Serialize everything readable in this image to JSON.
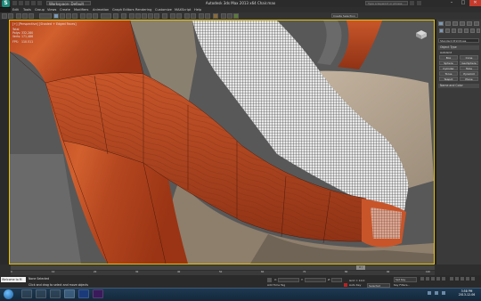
{
  "window": {
    "app_logo": "S",
    "workspace": "Workspace: Default",
    "title": "Autodesk 3ds Max  2013 x64     Chair.max",
    "search_placeholder": "Type a keyword or phrase"
  },
  "menu": [
    "Edit",
    "Tools",
    "Group",
    "Views",
    "Create",
    "Modifiers",
    "Animation",
    "Graph Editors",
    "Rendering",
    "Customize",
    "MAXScript",
    "Help"
  ],
  "toolbar": {
    "selection_set": "Create Selection Se"
  },
  "viewport": {
    "label": "[+] [Perspective] [Shaded + Edged Faces]",
    "stats": [
      {
        "label": "Total",
        "value": ""
      },
      {
        "label": "Polys:",
        "value": "332,280"
      },
      {
        "label": "Verts:",
        "value": "171,486"
      },
      {
        "label": "FPS:",
        "value": "110.511"
      }
    ]
  },
  "command_panel": {
    "dropdown": "Standard Primitives",
    "object_type_header": "Object Type",
    "autogrid": "AutoGrid",
    "buttons": [
      "Box",
      "Cone",
      "Sphere",
      "GeoSphere",
      "Cylinder",
      "Tube",
      "Torus",
      "Pyramid",
      "Teapot",
      "Plane"
    ],
    "name_color_header": "Name and Color"
  },
  "timeline": {
    "frame": "0 / 100",
    "ticks": [
      "0",
      "10",
      "20",
      "30",
      "40",
      "50",
      "60",
      "70",
      "80",
      "90",
      "100"
    ]
  },
  "status": {
    "maxscript_label": "Welcome to M",
    "selection": "None Selected",
    "prompt": "Click and drag to select and move objects",
    "x": "X:",
    "y": "Y:",
    "z": "Z:",
    "grid": "Grid = 10.0",
    "autokey": "Auto Key",
    "selected": "Selected",
    "set_key": "Set Key",
    "key_filters": "Key Filters...",
    "add_time_tag": "Add Time Tag"
  },
  "taskbar": {
    "apps": [
      "explorer",
      "ie",
      "media",
      "3dsmax",
      "photoshop",
      "premiere"
    ],
    "time": "3:58 PM",
    "date": "2013-12-06"
  }
}
